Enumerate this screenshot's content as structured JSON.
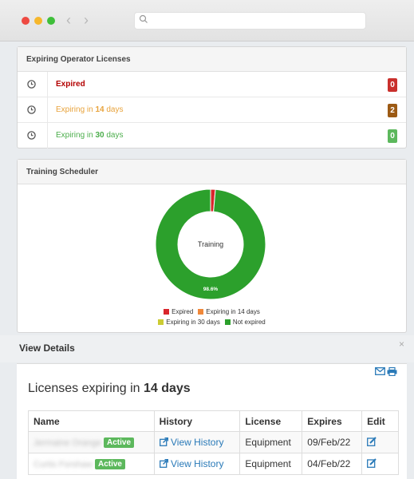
{
  "browser": {
    "search_placeholder": ""
  },
  "licenses_panel": {
    "title": "Expiring Operator Licenses",
    "rows": [
      {
        "label_pre": "Expired",
        "label_bold": "",
        "label_post": "",
        "count": "0",
        "color": "#b30000",
        "badge": "#c9302c"
      },
      {
        "label_pre": "Expiring in ",
        "label_bold": "14",
        "label_post": " days",
        "count": "2",
        "color": "#e8a33c",
        "badge": "#9c5a14"
      },
      {
        "label_pre": "Expiring in ",
        "label_bold": "30",
        "label_post": " days",
        "count": "0",
        "color": "#4cae4c",
        "badge": "#5cb85c"
      }
    ]
  },
  "training_panel": {
    "title": "Training Scheduler",
    "chart_data": {
      "type": "pie",
      "title": "",
      "center_label": "Training",
      "categories": [
        "Expired",
        "Expiring in 14 days",
        "Expiring in 30 days",
        "Not expired"
      ],
      "values": [
        1.4,
        0.0,
        0.0,
        98.6
      ],
      "colors": [
        "#d9262c",
        "#f0883a",
        "#cccc33",
        "#2ca02c"
      ],
      "data_labels": [
        "",
        "",
        "",
        "98.6%"
      ],
      "legend_placement": "bottom"
    }
  },
  "view_details": {
    "title": "View Details",
    "close": "×",
    "heading_pre": "Licenses expiring in ",
    "heading_bold": "14 days",
    "columns": [
      "Name",
      "History",
      "License",
      "Expires",
      "Edit"
    ],
    "rows": [
      {
        "name": "Jermaine Orange",
        "status": "Active",
        "history": "View History",
        "license": "Equipment",
        "expires": "09/Feb/22"
      },
      {
        "name": "Curtis Forshaw",
        "status": "Active",
        "history": "View History",
        "license": "Equipment",
        "expires": "04/Feb/22"
      }
    ]
  }
}
